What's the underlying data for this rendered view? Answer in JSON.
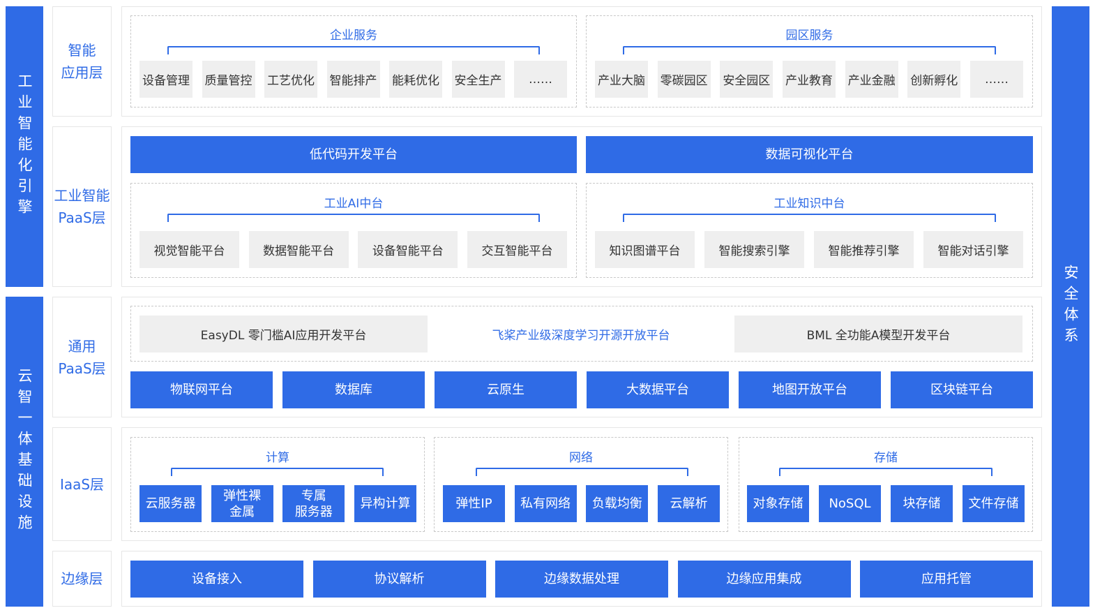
{
  "left_bars": {
    "top": "工业智能化引擎",
    "bottom": "云智一体基础设施"
  },
  "right_bar": "安全体系",
  "layers": {
    "app": "智能\n应用层",
    "industrial_paas": "工业智能\nPaaS层",
    "general_paas": "通用\nPaaS层",
    "iaas": "IaaS层",
    "edge": "边缘层"
  },
  "app_layer": {
    "enterprise": {
      "title": "企业服务",
      "items": [
        "设备管理",
        "质量管控",
        "工艺优化",
        "智能排产",
        "能耗优化",
        "安全生产",
        "……"
      ]
    },
    "park": {
      "title": "园区服务",
      "items": [
        "产业大脑",
        "零碳园区",
        "安全园区",
        "产业教育",
        "产业金融",
        "创新孵化",
        "……"
      ]
    }
  },
  "industrial_paas": {
    "lowcode": "低代码开发平台",
    "dataviz": "数据可视化平台",
    "ai": {
      "title": "工业AI中台",
      "items": [
        "视觉智能平台",
        "数据智能平台",
        "设备智能平台",
        "交互智能平台"
      ]
    },
    "knowledge": {
      "title": "工业知识中台",
      "items": [
        "知识图谱平台",
        "智能搜索引擎",
        "智能推荐引擎",
        "智能对话引擎"
      ]
    }
  },
  "general_paas": {
    "easydl": "EasyDL 零门槛AI应用开发平台",
    "paddle": "飞桨产业级深度学习开源开放平台",
    "bml": "BML 全功能A模型开发平台",
    "items": [
      "物联网平台",
      "数据库",
      "云原生",
      "大数据平台",
      "地图开放平台",
      "区块链平台"
    ]
  },
  "iaas": {
    "compute": {
      "title": "计算",
      "items": [
        "云服务器",
        "弹性裸\n金属",
        "专属\n服务器",
        "异构计算"
      ]
    },
    "network": {
      "title": "网络",
      "items": [
        "弹性IP",
        "私有网络",
        "负载均衡",
        "云解析"
      ]
    },
    "storage": {
      "title": "存储",
      "items": [
        "对象存储",
        "NoSQL",
        "块存储",
        "文件存储"
      ]
    }
  },
  "edge": {
    "items": [
      "设备接入",
      "协议解析",
      "边缘数据处理",
      "边缘应用集成",
      "应用托管"
    ]
  },
  "colors": {
    "accent": "#2f6be6",
    "tile": "#efefef"
  }
}
